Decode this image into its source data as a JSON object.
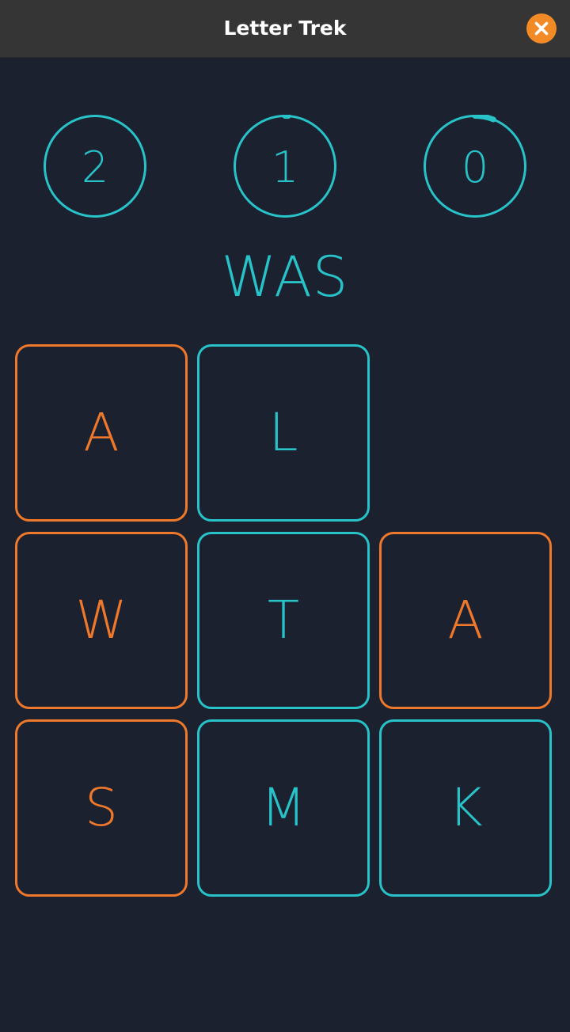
{
  "window": {
    "title": "Letter Trek",
    "close_icon": "close-icon"
  },
  "colors": {
    "background": "#1c2130",
    "titlebar": "#353535",
    "accent": "#28c3c8",
    "selected": "#f0782a",
    "close": "#f28a26"
  },
  "counters": [
    {
      "value": "2",
      "progress": 0
    },
    {
      "value": "1",
      "progress": 0.01
    },
    {
      "value": "0",
      "progress": 0.06
    }
  ],
  "current_word": "WAS",
  "grid": {
    "rows": [
      [
        {
          "letter": "A",
          "selected": true
        },
        {
          "letter": "L",
          "selected": false
        },
        null
      ],
      [
        {
          "letter": "W",
          "selected": true
        },
        {
          "letter": "T",
          "selected": false
        },
        {
          "letter": "A",
          "selected": true
        }
      ],
      [
        {
          "letter": "S",
          "selected": true
        },
        {
          "letter": "M",
          "selected": false
        },
        {
          "letter": "K",
          "selected": false
        }
      ]
    ]
  }
}
